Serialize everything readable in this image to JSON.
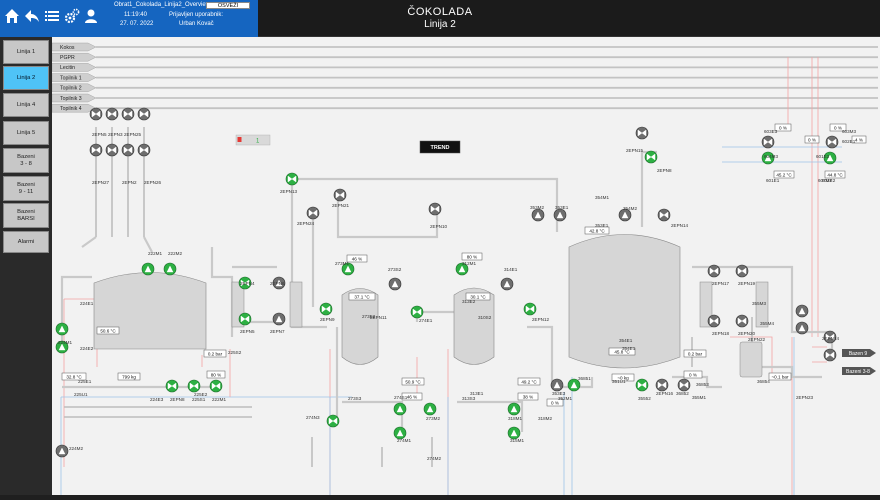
{
  "header": {
    "file_name": "Obrat1_Cokolada_Linija2_Overview",
    "time": "11:19:40",
    "date": "27. 07. 2022",
    "logged_in_label": "Prijavljen uporabnik:",
    "user": "Urban Kovač",
    "refresh_label": "OSVEŽI",
    "title": "ČOKOLADA",
    "subtitle": "Linija 2",
    "icons": [
      "home-icon",
      "back-arrow-icon",
      "menu-list-icon",
      "gears-icon",
      "user-icon"
    ]
  },
  "nav": {
    "items": [
      {
        "label": "Linija 1",
        "active": false
      },
      {
        "label": "Linija 2",
        "active": true
      },
      {
        "label": "Linija 4",
        "active": false
      },
      {
        "label": "Linija 5",
        "active": false
      },
      {
        "label": "Bazeni\n3 - 8",
        "active": false
      },
      {
        "label": "Bazeni\n9 - 11",
        "active": false
      },
      {
        "label": "Bazeni\nBARSI",
        "active": false
      },
      {
        "label": "Alarmi",
        "active": false
      }
    ]
  },
  "colors": {
    "header_blue": "#1565c0",
    "nav_active": "#4fc3f7",
    "pump_running": "#2db043",
    "pump_stopped": "#6e6e6e",
    "hot_line": "#f4a3a3",
    "cold_line": "#9ec3e6"
  },
  "supply_lines": [
    "Kokos",
    "PGPR",
    "Lecitin",
    "Topilnik 1",
    "Topilnik 2",
    "Topilnik 3",
    "Topilnik 4"
  ],
  "alarm_indicator": {
    "value": "1"
  },
  "trend_label": "TREND",
  "values": {
    "v_224e2": "50.6 °C",
    "v_225e1": "32.8 °C",
    "v_225ut": "799 kg",
    "v_222e3": "0.2 bar",
    "v_222m1": "80 %",
    "v_273m1": "46 %",
    "v_273e2": "37.1 °C",
    "v_312m1": "80 %",
    "v_313e2": "30.1 °C",
    "v_274e1": "50.9 °C",
    "v_274m1": "46 %",
    "v_315e1": "49.2 °C",
    "v_315m1": "38 %",
    "v_352m1": "0 %",
    "v_353e1": "42.8 °C",
    "v_354e1": "45.8 °C",
    "v_353ut": "~0 kg",
    "v_354e3": "0.2 bar",
    "v_351m1": "0 %",
    "v_601e": "45.2 °C",
    "v_602e": "44.8 °C",
    "v_601p": "0 %",
    "v_602p": "0 %",
    "v_601k": "0 %",
    "v_602k": "4 %",
    "v_386e": "~0.1 bar"
  },
  "destinations": [
    {
      "label": "Bazen 9"
    },
    {
      "label": "Bazeni 3-8"
    }
  ],
  "tags": {
    "ptop": [
      "2EPN5",
      "2EPN3",
      "2EPN25",
      "2EPN27",
      "2EPN2",
      "2EPN26"
    ],
    "p1": [
      "222M1",
      "222M2",
      "224E1",
      "224M1",
      "224E2",
      "225E1",
      "225U1",
      "224E3",
      "2EPN8",
      "225S1",
      "222M1",
      "225S2",
      "225E2"
    ],
    "p2": [
      "2EPN4",
      "2EPN6",
      "2EPN5",
      "2EPN7",
      "2EPN13",
      "2EPN21",
      "2EPN24",
      "2EPN9",
      "273M1",
      "273E2",
      "273S2",
      "274E1",
      "2EPN11",
      "274S1",
      "274M1",
      "273M2",
      "274N3",
      "274M2",
      "273S3"
    ],
    "p3": [
      "2EPN10",
      "312M1",
      "313E2",
      "310S2",
      "314E1",
      "2EPN12",
      "313E1",
      "315M1",
      "318M1",
      "313S3",
      "318M2"
    ],
    "p4": [
      "353M2",
      "353E1",
      "354M1",
      "354M2",
      "353E1",
      "2EPN14",
      "2EPN15",
      "2EPN8",
      "354E1",
      "353E3",
      "352M1",
      "36851",
      "354E1",
      "351U1",
      "35552",
      "2EPN16",
      "36852",
      "355M1"
    ],
    "p5": [
      "2EPN17",
      "2EPN19",
      "2EPN18",
      "2EPN20",
      "355M3",
      "355M4",
      "2EPN22",
      "36853",
      "2EPN14",
      "2EPN23",
      "36854"
    ],
    "p6": [
      "603E3",
      "604M3",
      "601E1",
      "601E2",
      "607M2",
      "603M3",
      "602E1",
      "602E2"
    ],
    "misc": [
      "224M2"
    ]
  }
}
